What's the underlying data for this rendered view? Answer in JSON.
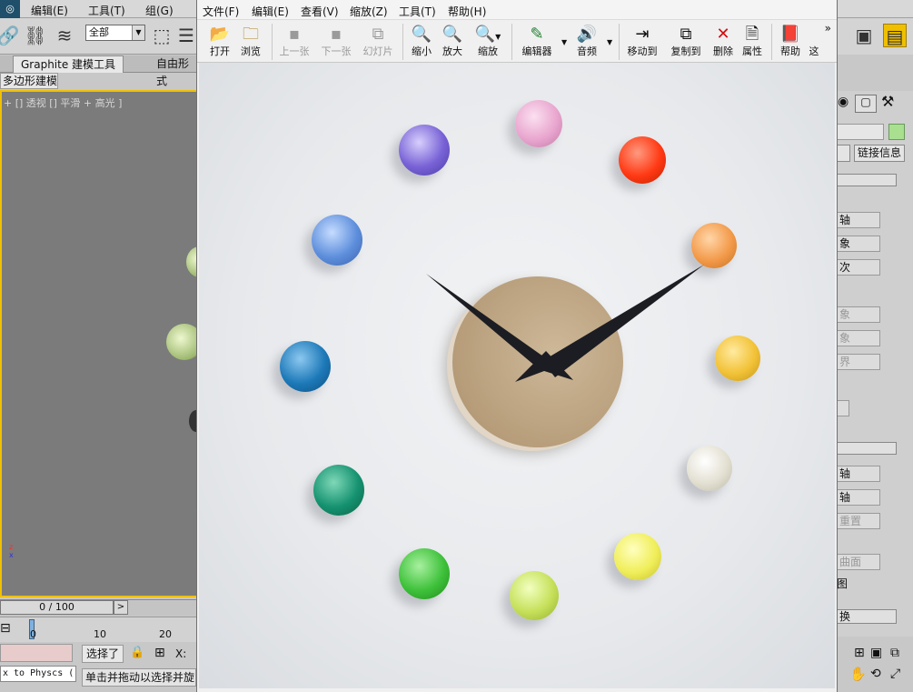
{
  "background_app": {
    "menus": [
      "编辑(E)",
      "工具(T)",
      "组(G)"
    ],
    "selection_filter": "全部",
    "ribbon_tabs": [
      "Graphite 建模工具",
      "自由形式"
    ],
    "subtab": "多边形建模",
    "viewport_label": "+ [] 透视 [] 平滑 + 高光 ]",
    "time_slider": "0 / 100",
    "time_next": ">",
    "ruler_ticks": [
      "0",
      "10",
      "20"
    ],
    "maxscript_prompt": "x to Physcs (",
    "selection_status": "选择了",
    "coord_label": "X:",
    "prompt_line": "单击并拖动以选择并旋",
    "right_panel": {
      "link_info": "链接信息",
      "buttons": [
        "轴",
        "象",
        "次",
        "象",
        "象",
        "界",
        "轴",
        "轴",
        "重置",
        "曲面",
        "图",
        "换"
      ]
    }
  },
  "viewer": {
    "menus": [
      "文件(F)",
      "编辑(E)",
      "查看(V)",
      "缩放(Z)",
      "工具(T)",
      "帮助(H)"
    ],
    "toolbar": {
      "open": "打开",
      "browse": "浏览",
      "prev": "上一张",
      "next": "下一张",
      "slideshow": "幻灯片",
      "zoom_out": "缩小",
      "zoom_in": "放大",
      "zoom": "缩放",
      "editor": "编辑器",
      "audio": "音频",
      "move_to": "移动到",
      "copy_to": "复制到",
      "delete": "删除",
      "properties": "属性",
      "help": "帮助",
      "more_cut": "这",
      "overflow": "»"
    },
    "photo": {
      "subject": "wall clock with colored knobs",
      "knob_colors": [
        "#e9a6cf",
        "#ff3a14",
        "#f39a4a",
        "#f2c237",
        "#e3e0d2",
        "#f0ee5a",
        "#c6e05a",
        "#3ec13a",
        "#159270",
        "#1d79b8",
        "#5e8fdc",
        "#7862d6"
      ]
    }
  }
}
